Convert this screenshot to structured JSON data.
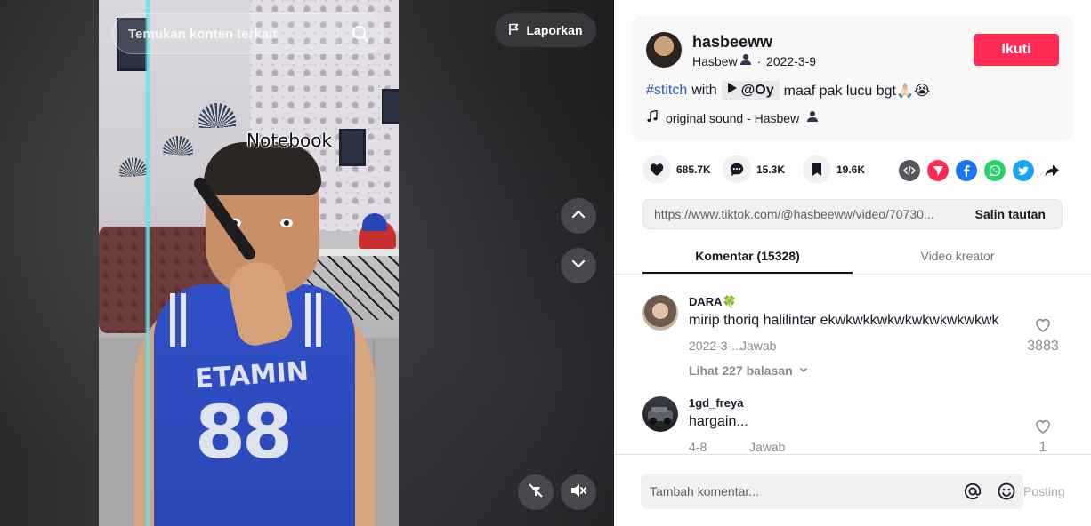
{
  "video": {
    "search_placeholder": "Temukan konten terkait",
    "report_label": "Laporkan",
    "overlay_text": "Notebook",
    "shirt_number": "88",
    "shirt_word": "ETAMIN"
  },
  "author": {
    "username": "hasbeeww",
    "nickname": "Hasbew",
    "date": "2022-3-9",
    "follow_label": "Ikuti"
  },
  "description": {
    "hashtag": "#stitch",
    "with": "with",
    "mention": "@Oy",
    "caption": "maaf pak lucu bgt🙏🏻😭"
  },
  "music": {
    "label": "original sound - Hasbew"
  },
  "stats": {
    "likes": "685.7K",
    "comments": "15.3K",
    "saves": "19.6K"
  },
  "link": {
    "url": "https://www.tiktok.com/@hasbeeww/video/70730...",
    "copy_label": "Salin tautan"
  },
  "tabs": [
    {
      "label": "Komentar (15328)"
    },
    {
      "label": "Video kreator"
    }
  ],
  "comments": [
    {
      "user": "DARA🍀",
      "text": "mirip thoriq halilintar ekwkwkkwkwkwkwkwkwkwk",
      "date": "2022-3-...",
      "reply_label": "Jawab",
      "likes": "3883",
      "view_replies": "Lihat 227 balasan"
    },
    {
      "user": "1gd_freya",
      "text": "hargain...",
      "date": "4-8",
      "reply_label": "Jawab",
      "likes": "1"
    }
  ],
  "composer": {
    "placeholder": "Tambah komentar...",
    "post_label": "Posting"
  },
  "colors": {
    "accent": "#fe2c55",
    "hashtag": "#2b5db9",
    "text": "#161823",
    "muted": "#8a8b91"
  }
}
